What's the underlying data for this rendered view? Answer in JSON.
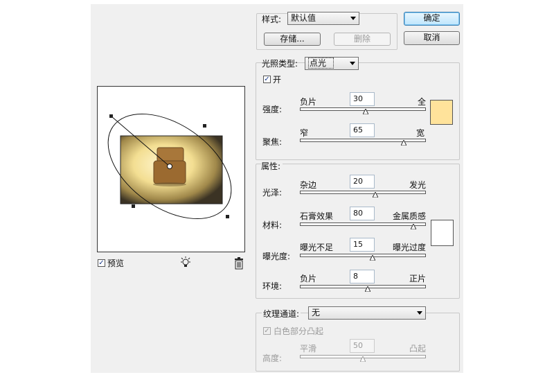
{
  "style": {
    "label": "样式:",
    "value": "默认值",
    "save_label": "存储...",
    "delete_label": "删除"
  },
  "buttons": {
    "ok": "确定",
    "cancel": "取消"
  },
  "light": {
    "type_label": "光照类型:",
    "type_value": "点光",
    "on_label": "开",
    "on_checked": true,
    "intensity": {
      "label": "强度:",
      "min_label": "负片",
      "max_label": "全",
      "value": "30",
      "fraction": 0.52
    },
    "focus": {
      "label": "聚焦:",
      "min_label": "窄",
      "max_label": "宽",
      "value": "65",
      "fraction": 0.825
    },
    "color": "#ffe39b"
  },
  "properties": {
    "title": "属性:",
    "gloss": {
      "label": "光泽:",
      "min_label": "杂边",
      "max_label": "发光",
      "value": "20",
      "fraction": 0.6
    },
    "material": {
      "label": "材料:",
      "min_label": "石膏效果",
      "max_label": "金属质感",
      "value": "80",
      "fraction": 0.9
    },
    "exposure": {
      "label": "曝光度:",
      "min_label": "曝光不足",
      "max_label": "曝光过度",
      "value": "15",
      "fraction": 0.575
    },
    "ambience": {
      "label": "环境:",
      "min_label": "负片",
      "max_label": "正片",
      "value": "8",
      "fraction": 0.54
    },
    "color": "#ffffff"
  },
  "texture": {
    "channel_label": "纹理通道:",
    "channel_value": "无",
    "white_high_label": "白色部分凸起",
    "white_high_checked": true,
    "height": {
      "label": "高度:",
      "min_label": "平滑",
      "max_label": "凸起",
      "value": "50",
      "fraction": 0.5
    }
  },
  "preview": {
    "label": "预览",
    "checked": true
  },
  "icons": {
    "light_bulb": "light-bulb-icon",
    "trash": "trash-icon"
  }
}
